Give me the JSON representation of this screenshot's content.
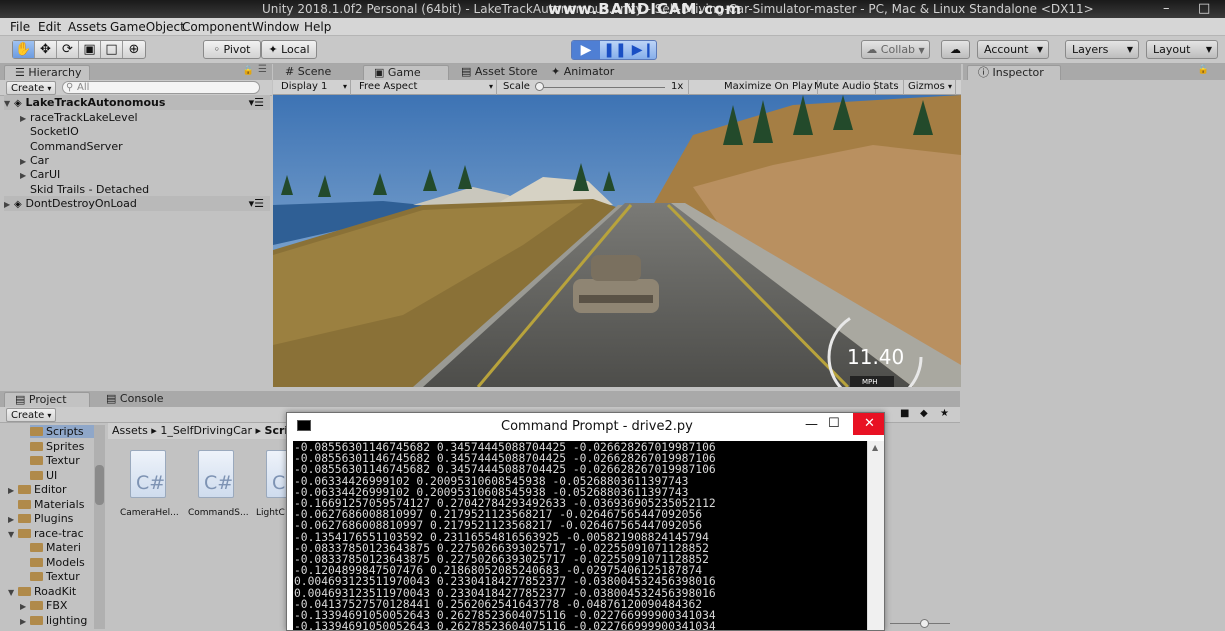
{
  "window": {
    "title": "Unity 2018.1.0f2 Personal (64bit) - LakeTrackAutonomous.unity - Self-Driving-Car-Simulator-master - PC, Mac & Linux Standalone <DX11>",
    "watermark": "www.BANDICAM.com",
    "minimize": "–",
    "maximize": "□"
  },
  "menubar": [
    "File",
    "Edit",
    "Assets",
    "GameObject",
    "Component",
    "Window",
    "Help"
  ],
  "toolbar": {
    "tools": [
      "hand-icon",
      "move-icon",
      "rotate-icon",
      "scale-icon",
      "rect-icon",
      "transform-icon"
    ],
    "pivot": "Pivot",
    "local": "Local",
    "collab": "Collab",
    "account": "Account",
    "layers": "Layers",
    "layout": "Layout"
  },
  "hierarchy": {
    "tab": "Hierarchy",
    "create": "Create",
    "search_placeholder": "All",
    "scene": "LakeTrackAutonomous",
    "items": [
      {
        "label": "raceTrackLakeLevel",
        "expandable": true
      },
      {
        "label": "SocketIO",
        "expandable": false
      },
      {
        "label": "CommandServer",
        "expandable": false
      },
      {
        "label": "Car",
        "expandable": true
      },
      {
        "label": "CarUI",
        "expandable": true
      },
      {
        "label": "Skid Trails - Detached",
        "expandable": false
      }
    ],
    "dont_destroy": "DontDestroyOnLoad"
  },
  "center_tabs": [
    "Scene",
    "Game",
    "Asset Store",
    "Animator"
  ],
  "game_toolbar": {
    "display": "Display 1",
    "aspect": "Free Aspect",
    "scale_label": "Scale",
    "scale_value": "1x",
    "maximize": "Maximize On Play",
    "mute": "Mute Audio",
    "stats": "Stats",
    "gizmos": "Gizmos"
  },
  "game_view": {
    "speed": "11.40",
    "unit": "MPH"
  },
  "inspector": {
    "tab": "Inspector"
  },
  "project": {
    "tabs": [
      "Project",
      "Console"
    ],
    "create": "Create",
    "tree": [
      {
        "label": "Scripts",
        "indent": 2,
        "selected": true
      },
      {
        "label": "Sprites",
        "indent": 2
      },
      {
        "label": "Textur",
        "indent": 2
      },
      {
        "label": "UI",
        "indent": 2
      },
      {
        "label": "Editor",
        "indent": 1,
        "expandable": true
      },
      {
        "label": "Materials",
        "indent": 1
      },
      {
        "label": "Plugins",
        "indent": 1,
        "expandable": true
      },
      {
        "label": "race-trac",
        "indent": 1,
        "expandable": true,
        "open": true
      },
      {
        "label": "Materi",
        "indent": 2
      },
      {
        "label": "Models",
        "indent": 2
      },
      {
        "label": "Textur",
        "indent": 2
      },
      {
        "label": "RoadKit",
        "indent": 1,
        "expandable": true,
        "open": true
      },
      {
        "label": "FBX",
        "indent": 2,
        "expandable": true
      },
      {
        "label": "lighting",
        "indent": 2,
        "expandable": true
      }
    ],
    "breadcrumb": [
      "Assets",
      "1_SelfDrivingCar",
      "Scri"
    ],
    "assets": [
      {
        "icon": "C#",
        "name": "CameraHel..."
      },
      {
        "icon": "C#",
        "name": "CommandS..."
      },
      {
        "icon": "C",
        "name": "LightC"
      }
    ]
  },
  "cmd": {
    "title": "Command Prompt - drive2.py",
    "close": "✕",
    "lines": [
      "-0.08556301146745682 0.34574445088704425 -0.026628267019987106",
      "-0.08556301146745682 0.34574445088704425 -0.026628267019987106",
      "-0.08556301146745682 0.34574445088704425 -0.026628267019987106",
      "-0.06334426999102 0.20095310608545938 -0.05268803611397743",
      "-0.06334426999102 0.20095310608545938 -0.05268803611397743",
      "-0.16691257059574127 0.27042784293492633 -0.036936905235052112",
      "-0.0627686008810997 0.2179521123568217 -0.026467565447092056",
      "-0.0627686008810997 0.2179521123568217 -0.026467565447092056",
      "-0.1354176551103592 0.23116554816563925 -0.005821908824145794",
      "-0.08337850123643875 0.22750266393025717 -0.02255091071128852",
      "-0.08337850123643875 0.22750266393025717 -0.02255091071128852",
      "-0.1204899847507476 0.21868052085240683 -0.02975406125187874",
      "0.004693123511970043 0.23304184277852377 -0.038004532456398016",
      "0.004693123511970043 0.23304184277852377 -0.038004532456398016",
      "-0.04137527570128441 0.2562062541643778 -0.04876120090484362",
      "-0.13394691050052643 0.26278523604075116 -0.022766999900341034",
      "-0.13394691050052643 0.26278523604075116 -0.022766999900341034",
      "-0.13394691050052643 0.26278523604075116 -0.022766999900341034"
    ]
  }
}
